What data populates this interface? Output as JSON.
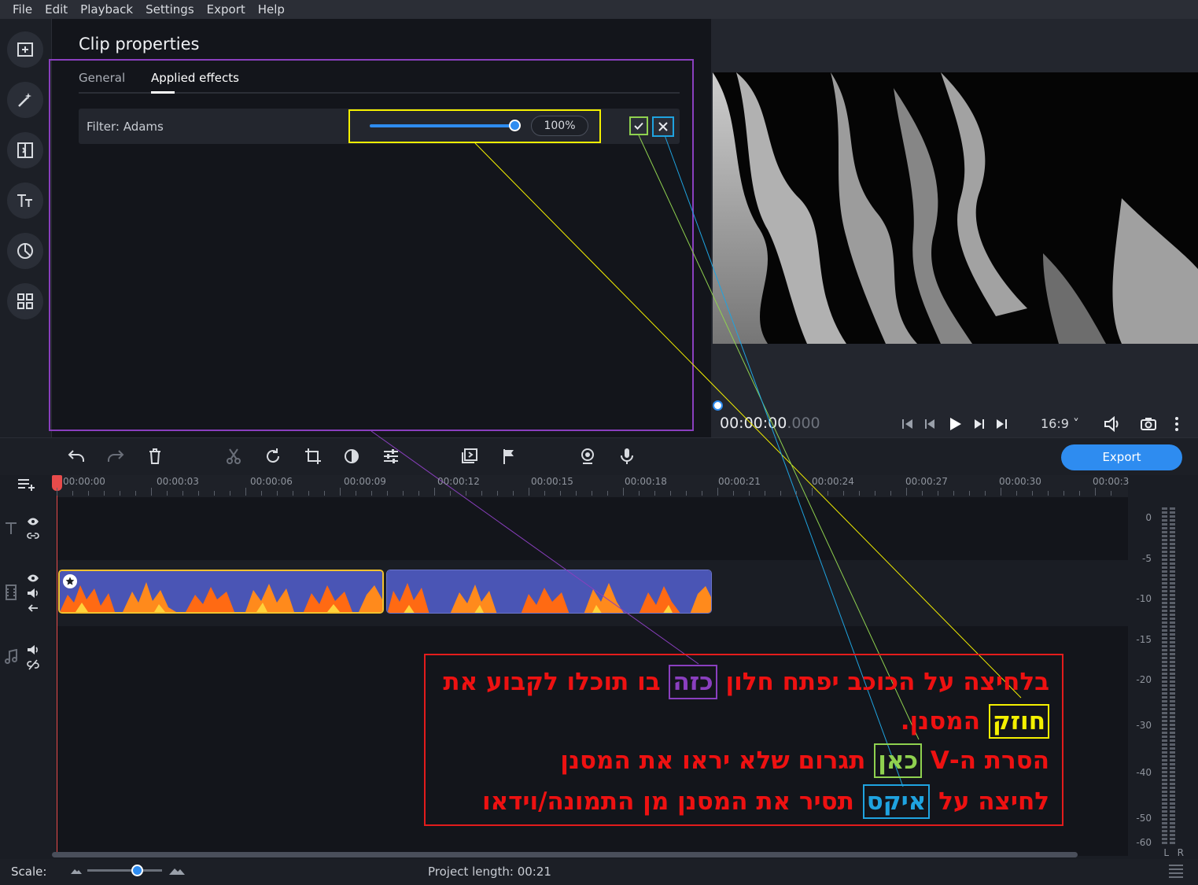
{
  "menu": [
    "File",
    "Edit",
    "Playback",
    "Settings",
    "Export",
    "Help"
  ],
  "rail_icons": [
    "import-icon",
    "magic-wand-icon",
    "transitions-icon",
    "titles-icon",
    "stickers-icon",
    "more-tools-icon"
  ],
  "clip_properties": {
    "title": "Clip properties",
    "tabs": {
      "general": "General",
      "applied_effects": "Applied effects"
    },
    "effect": {
      "name": "Filter: Adams",
      "strength_text": "100%",
      "strength": 1.0
    }
  },
  "preview": {
    "timecode_main": "00:00:00",
    "timecode_ms": ".000",
    "aspect": "16:9 ˅"
  },
  "toolbar": {
    "export_label": "Export"
  },
  "timeline": {
    "ticks": [
      "00:00:00",
      "00:00:03",
      "00:00:06",
      "00:00:09",
      "00:00:12",
      "00:00:15",
      "00:00:18",
      "00:00:21",
      "00:00:24",
      "00:00:27",
      "00:00:30",
      "00:00:3"
    ]
  },
  "meter": {
    "labels": [
      "0",
      "-5",
      "-10",
      "-15",
      "-20",
      "-30",
      "-40",
      "-50",
      "-60"
    ],
    "channels": {
      "left": "L",
      "right": "R"
    }
  },
  "status": {
    "scale_label": "Scale:",
    "project_length": "Project length:  00:21"
  },
  "annotation": {
    "line1_a": "בלחיצה על הכוכב יפתח חלון ",
    "line1_hl": "כזה",
    "line1_b": " בו תוכלו לקבוע את",
    "line2_hl": "חוזק",
    "line2_b": " המסנן.",
    "line3_a": "הסרת ה-V ",
    "line3_hl": "כאן",
    "line3_b": " תגרום שלא יראו את המסנן",
    "line4_a": "לחיצה על ",
    "line4_hl": "איקס",
    "line4_b": " תסיר את המסנן מן התמונה/וידאו"
  },
  "colors": {
    "accent": "#2e8cf0",
    "annotation_red": "#ee1111",
    "annotation_purple": "#8a3fbf",
    "annotation_yellow": "#f4f000",
    "annotation_green": "#8fd14f",
    "annotation_blue": "#1fa3e0"
  }
}
